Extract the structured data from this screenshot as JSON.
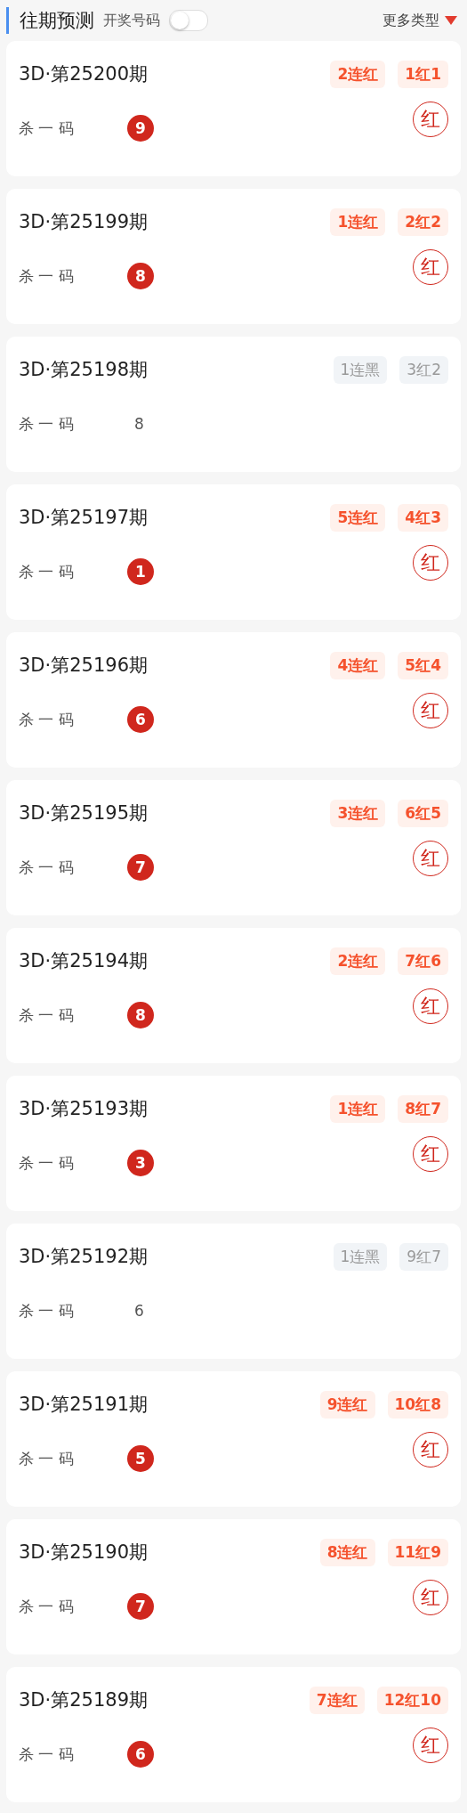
{
  "header": {
    "title": "往期预测",
    "toggle": {
      "label": "开奖号码",
      "on": false
    },
    "more": "更多类型"
  },
  "cards": [
    {
      "title": "3D·第25200期",
      "streak": "2连红",
      "record": "1红1",
      "label": "杀 一 码",
      "number": "9",
      "hit": true,
      "stamp": "红"
    },
    {
      "title": "3D·第25199期",
      "streak": "1连红",
      "record": "2红2",
      "label": "杀 一 码",
      "number": "8",
      "hit": true,
      "stamp": "红"
    },
    {
      "title": "3D·第25198期",
      "streak": "1连黑",
      "record": "3红2",
      "label": "杀 一 码",
      "number": "8",
      "hit": false
    },
    {
      "title": "3D·第25197期",
      "streak": "5连红",
      "record": "4红3",
      "label": "杀 一 码",
      "number": "1",
      "hit": true,
      "stamp": "红"
    },
    {
      "title": "3D·第25196期",
      "streak": "4连红",
      "record": "5红4",
      "label": "杀 一 码",
      "number": "6",
      "hit": true,
      "stamp": "红"
    },
    {
      "title": "3D·第25195期",
      "streak": "3连红",
      "record": "6红5",
      "label": "杀 一 码",
      "number": "7",
      "hit": true,
      "stamp": "红"
    },
    {
      "title": "3D·第25194期",
      "streak": "2连红",
      "record": "7红6",
      "label": "杀 一 码",
      "number": "8",
      "hit": true,
      "stamp": "红"
    },
    {
      "title": "3D·第25193期",
      "streak": "1连红",
      "record": "8红7",
      "label": "杀 一 码",
      "number": "3",
      "hit": true,
      "stamp": "红"
    },
    {
      "title": "3D·第25192期",
      "streak": "1连黑",
      "record": "9红7",
      "label": "杀 一 码",
      "number": "6",
      "hit": false
    },
    {
      "title": "3D·第25191期",
      "streak": "9连红",
      "record": "10红8",
      "label": "杀 一 码",
      "number": "5",
      "hit": true,
      "stamp": "红"
    },
    {
      "title": "3D·第25190期",
      "streak": "8连红",
      "record": "11红9",
      "label": "杀 一 码",
      "number": "7",
      "hit": true,
      "stamp": "红"
    },
    {
      "title": "3D·第25189期",
      "streak": "7连红",
      "record": "12红10",
      "label": "杀 一 码",
      "number": "6",
      "hit": true,
      "stamp": "红"
    }
  ]
}
